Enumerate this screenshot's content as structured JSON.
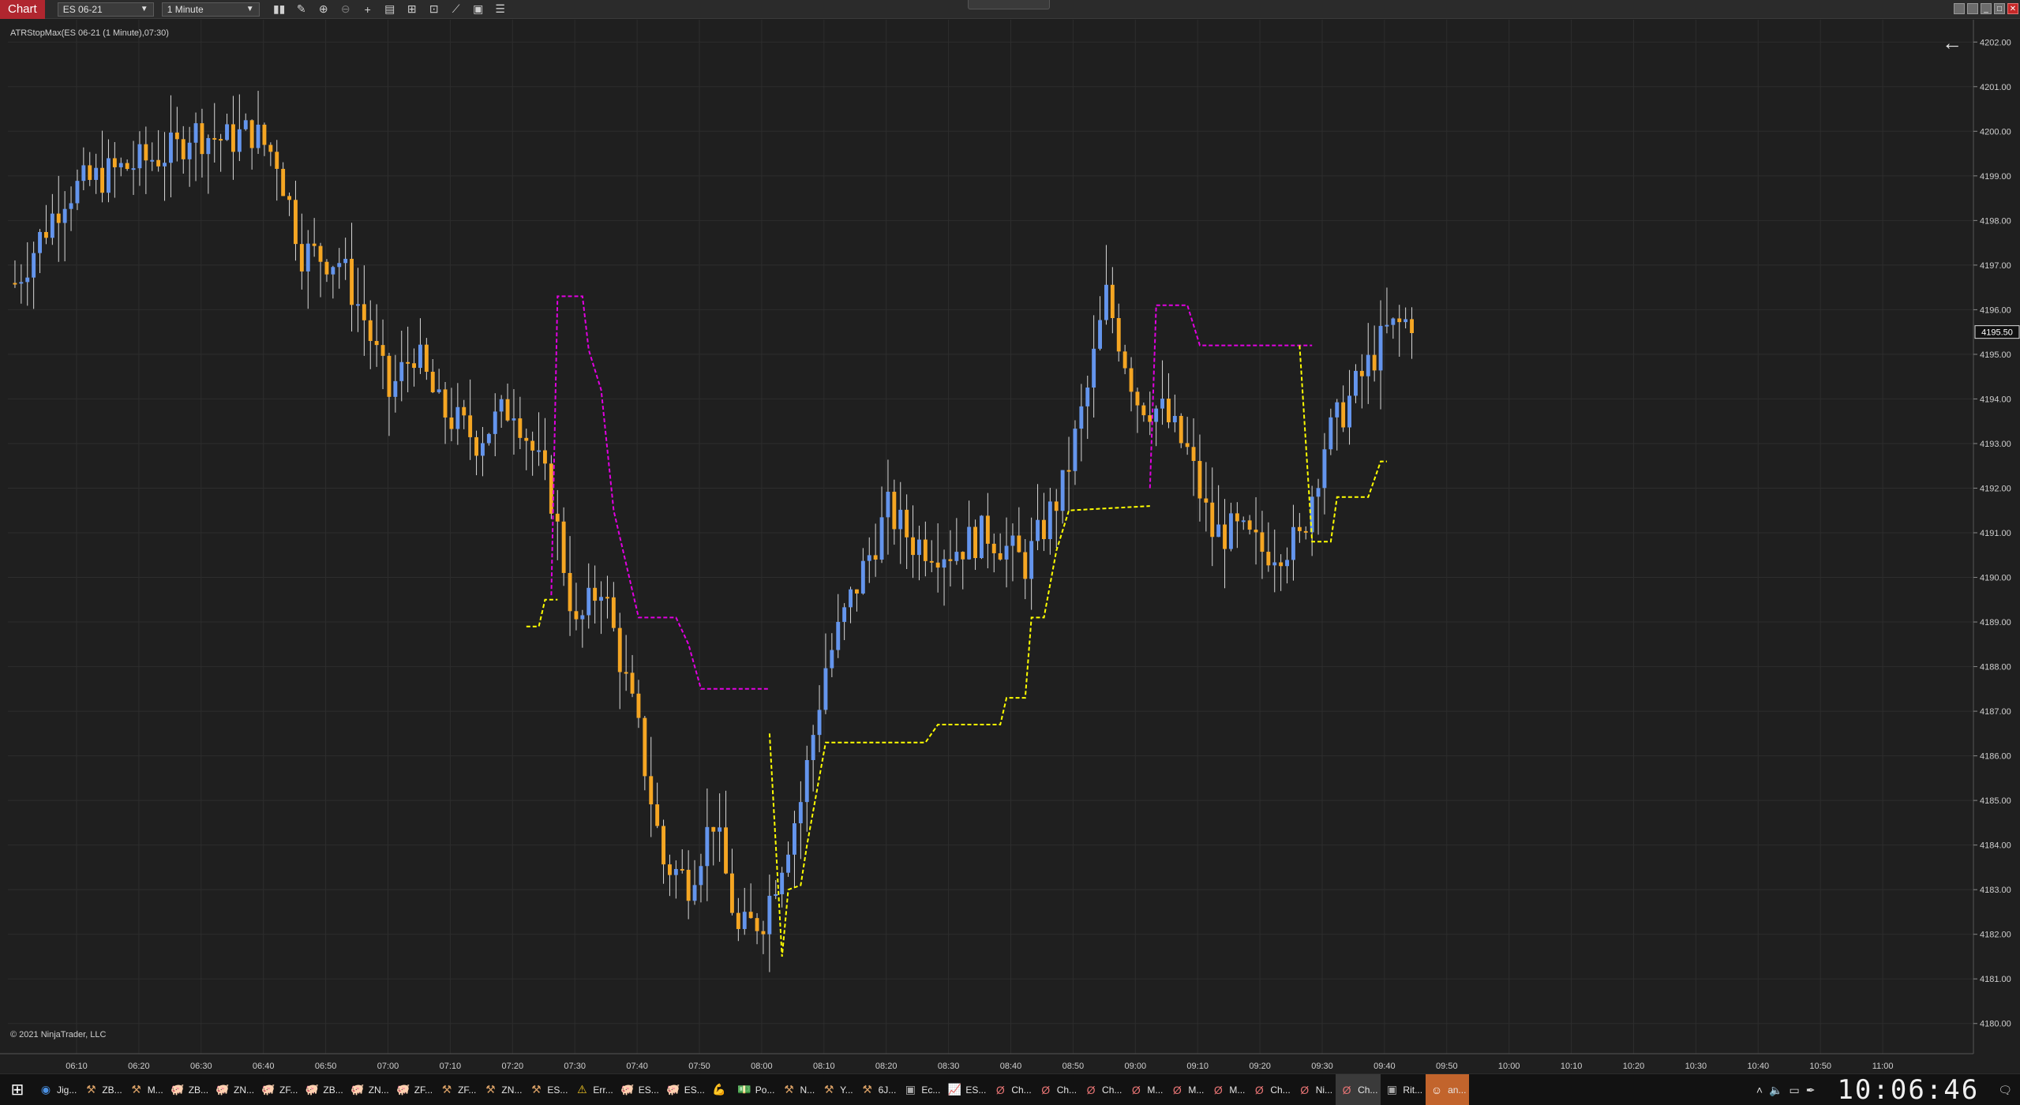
{
  "toolbar": {
    "window_title": "Chart",
    "instrument": "ES 06-21",
    "interval": "1 Minute",
    "tools": [
      "bar-style-icon",
      "draw-pencil-icon",
      "zoom-in-icon",
      "zoom-out-icon",
      "crosshair-icon",
      "data-box-icon",
      "chart-style-icon",
      "screenshot-icon",
      "strategy-icon",
      "properties-icon",
      "list-icon"
    ]
  },
  "chart": {
    "indicator_label": "ATRStopMax(ES 06-21 (1 Minute),07:30)",
    "copyright": "© 2021 NinjaTrader, LLC",
    "current_price_label": "4195.50",
    "colors": {
      "background": "#1f1f1f",
      "up_bar": "#6495ed",
      "down_bar": "#f5a623",
      "upper_stop": "#e100e1",
      "lower_stop": "#ffff00",
      "grid": "#2d2d2d"
    }
  },
  "chart_data": {
    "type": "candlestick",
    "instrument": "ES 06-21",
    "interval": "1 Minute",
    "y_axis": {
      "min": 4179.5,
      "max": 4202.5,
      "ticks": [
        "4180.00",
        "4181.00",
        "4182.00",
        "4183.00",
        "4184.00",
        "4185.00",
        "4186.00",
        "4187.00",
        "4188.00",
        "4189.00",
        "4190.00",
        "4191.00",
        "4192.00",
        "4193.00",
        "4194.00",
        "4195.00",
        "4196.00",
        "4197.00",
        "4198.00",
        "4199.00",
        "4200.00",
        "4201.00",
        "4202.00"
      ]
    },
    "x_axis": {
      "ticks": [
        "06:10",
        "06:20",
        "06:30",
        "06:40",
        "06:50",
        "07:00",
        "07:10",
        "07:20",
        "07:30",
        "07:40",
        "07:50",
        "08:00",
        "08:10",
        "08:20",
        "08:30",
        "08:40",
        "08:50",
        "09:00",
        "09:10",
        "09:20",
        "09:30",
        "09:40",
        "09:50",
        "10:00",
        "10:10",
        "10:20",
        "10:30",
        "10:40",
        "10:50",
        "11:00"
      ]
    },
    "price_path": [
      [
        0,
        4196.6
      ],
      [
        8,
        4198.6
      ],
      [
        14,
        4199.0
      ],
      [
        20,
        4199.3
      ],
      [
        26,
        4199.6
      ],
      [
        28,
        4200.0
      ],
      [
        34,
        4199.8
      ],
      [
        38,
        4200.0
      ],
      [
        42,
        4199.4
      ],
      [
        46,
        4197.3
      ],
      [
        52,
        4197.1
      ],
      [
        56,
        4195.8
      ],
      [
        60,
        4194.1
      ],
      [
        64,
        4195.1
      ],
      [
        68,
        4193.8
      ],
      [
        74,
        4193.1
      ],
      [
        80,
        4193.9
      ],
      [
        86,
        4191.8
      ],
      [
        90,
        4188.8
      ],
      [
        94,
        4189.9
      ],
      [
        100,
        4186.5
      ],
      [
        104,
        4183.6
      ],
      [
        108,
        4183.2
      ],
      [
        112,
        4184.6
      ],
      [
        116,
        4182.0
      ],
      [
        120,
        4182.4
      ],
      [
        126,
        4185.0
      ],
      [
        130,
        4188.0
      ],
      [
        134,
        4189.5
      ],
      [
        140,
        4191.5
      ],
      [
        144,
        4190.8
      ],
      [
        150,
        4190.6
      ],
      [
        156,
        4191.0
      ],
      [
        162,
        4190.3
      ],
      [
        168,
        4192.0
      ],
      [
        172,
        4194.2
      ],
      [
        175,
        4196.3
      ],
      [
        180,
        4194.0
      ],
      [
        184,
        4193.7
      ],
      [
        188,
        4192.8
      ],
      [
        192,
        4191.0
      ],
      [
        196,
        4191.0
      ],
      [
        200,
        4190.6
      ],
      [
        206,
        4190.8
      ],
      [
        210,
        4193.0
      ],
      [
        214,
        4194.0
      ],
      [
        220,
        4195.5
      ],
      [
        224,
        4195.8
      ]
    ],
    "series": [
      {
        "name": "ATRStopMax upper",
        "color": "#e100e1",
        "points": [
          [
            86,
            4189.6
          ],
          [
            87,
            4196.3
          ],
          [
            91,
            4196.3
          ],
          [
            92,
            4195.1
          ],
          [
            94,
            4194.2
          ],
          [
            96,
            4191.5
          ],
          [
            100,
            4189.1
          ],
          [
            106,
            4189.1
          ],
          [
            108,
            4188.5
          ],
          [
            110,
            4187.5
          ],
          [
            120,
            4187.5
          ],
          [
            121,
            4187.5
          ],
          [
            null,
            null
          ],
          [
            182,
            4192.0
          ],
          [
            183,
            4196.1
          ],
          [
            188,
            4196.1
          ],
          [
            190,
            4195.2
          ],
          [
            208,
            4195.2
          ]
        ]
      },
      {
        "name": "ATRStopMax lower",
        "color": "#ffff00",
        "points": [
          [
            82,
            4188.9
          ],
          [
            84,
            4188.9
          ],
          [
            85,
            4189.5
          ],
          [
            87,
            4189.5
          ],
          [
            null,
            null
          ],
          [
            121,
            4186.5
          ],
          [
            123,
            4181.5
          ],
          [
            124,
            4183.0
          ],
          [
            126,
            4183.1
          ],
          [
            127,
            4184.0
          ],
          [
            130,
            4186.3
          ],
          [
            146,
            4186.3
          ],
          [
            148,
            4186.7
          ],
          [
            158,
            4186.7
          ],
          [
            159,
            4187.3
          ],
          [
            162,
            4187.3
          ],
          [
            163,
            4189.1
          ],
          [
            165,
            4189.1
          ],
          [
            167,
            4190.6
          ],
          [
            169,
            4191.5
          ],
          [
            182,
            4191.6
          ],
          [
            null,
            null
          ],
          [
            206,
            4195.2
          ],
          [
            208,
            4190.8
          ],
          [
            211,
            4190.8
          ],
          [
            212,
            4191.8
          ],
          [
            217,
            4191.8
          ],
          [
            219,
            4192.6
          ],
          [
            220,
            4192.6
          ]
        ]
      }
    ]
  },
  "taskbar": {
    "items": [
      {
        "icon": "chrome-icon",
        "label": "Jig..."
      },
      {
        "icon": "gavel-icon",
        "label": "ZB..."
      },
      {
        "icon": "gavel-icon",
        "label": "M..."
      },
      {
        "icon": "pig-icon",
        "label": "ZB..."
      },
      {
        "icon": "pig-icon",
        "label": "ZN..."
      },
      {
        "icon": "pig-icon",
        "label": "ZF..."
      },
      {
        "icon": "pig-icon",
        "label": "ZB..."
      },
      {
        "icon": "pig-icon",
        "label": "ZN..."
      },
      {
        "icon": "pig-icon",
        "label": "ZF..."
      },
      {
        "icon": "gavel-icon",
        "label": "ZF..."
      },
      {
        "icon": "gavel-icon",
        "label": "ZN..."
      },
      {
        "icon": "gavel-icon",
        "label": "ES..."
      },
      {
        "icon": "warning-icon",
        "label": "Err..."
      },
      {
        "icon": "pig-icon",
        "label": "ES..."
      },
      {
        "icon": "pig-icon",
        "label": "ES..."
      },
      {
        "icon": "arm-icon",
        "label": ""
      },
      {
        "icon": "money-icon",
        "label": "Po..."
      },
      {
        "icon": "gavel-icon",
        "label": "N..."
      },
      {
        "icon": "gavel-icon",
        "label": "Y..."
      },
      {
        "icon": "gavel-icon",
        "label": "6J..."
      },
      {
        "icon": "app-icon",
        "label": "Ec..."
      },
      {
        "icon": "chart-line-icon",
        "label": "ES..."
      },
      {
        "icon": "ninja-icon",
        "label": "Ch..."
      },
      {
        "icon": "ninja-icon",
        "label": "Ch..."
      },
      {
        "icon": "ninja-icon",
        "label": "Ch..."
      },
      {
        "icon": "ninja-icon",
        "label": "M..."
      },
      {
        "icon": "ninja-icon",
        "label": "M..."
      },
      {
        "icon": "ninja-icon",
        "label": "M..."
      },
      {
        "icon": "ninja-icon",
        "label": "Ch..."
      },
      {
        "icon": "ninja-icon",
        "label": "Ni..."
      },
      {
        "icon": "ninja-icon",
        "label": "Ch..."
      },
      {
        "icon": "app-icon",
        "label": "Rit..."
      },
      {
        "icon": "discord-icon",
        "label": "an..."
      }
    ],
    "clock": "10:06:46"
  }
}
